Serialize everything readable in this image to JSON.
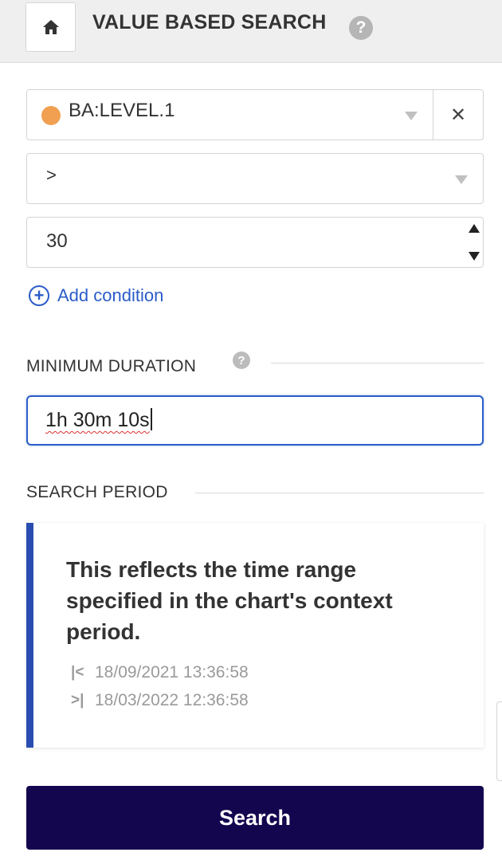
{
  "header": {
    "title": "VALUE BASED SEARCH",
    "home_icon": "home-icon",
    "help_icon": "help-icon",
    "help_symbol": "?"
  },
  "condition": {
    "signal": "BA:LEVEL.1",
    "signal_color": "#f0a050",
    "operator": ">",
    "value": "30",
    "clear_symbol": "✕"
  },
  "add_condition": {
    "symbol": "+",
    "label": "Add condition"
  },
  "minimum_duration": {
    "title": "MINIMUM DURATION",
    "help_symbol": "?",
    "value": "1h 30m 10s"
  },
  "search_period": {
    "title": "SEARCH PERIOD",
    "description": "This reflects the time range specified in the chart's context period.",
    "start_icon": "|<",
    "end_icon": ">|",
    "start": "18/09/2021 13:36:58",
    "end": "18/03/2022 12:36:58",
    "accent_color": "#2a4db2"
  },
  "search_button": {
    "label": "Search",
    "color": "#14054f"
  }
}
